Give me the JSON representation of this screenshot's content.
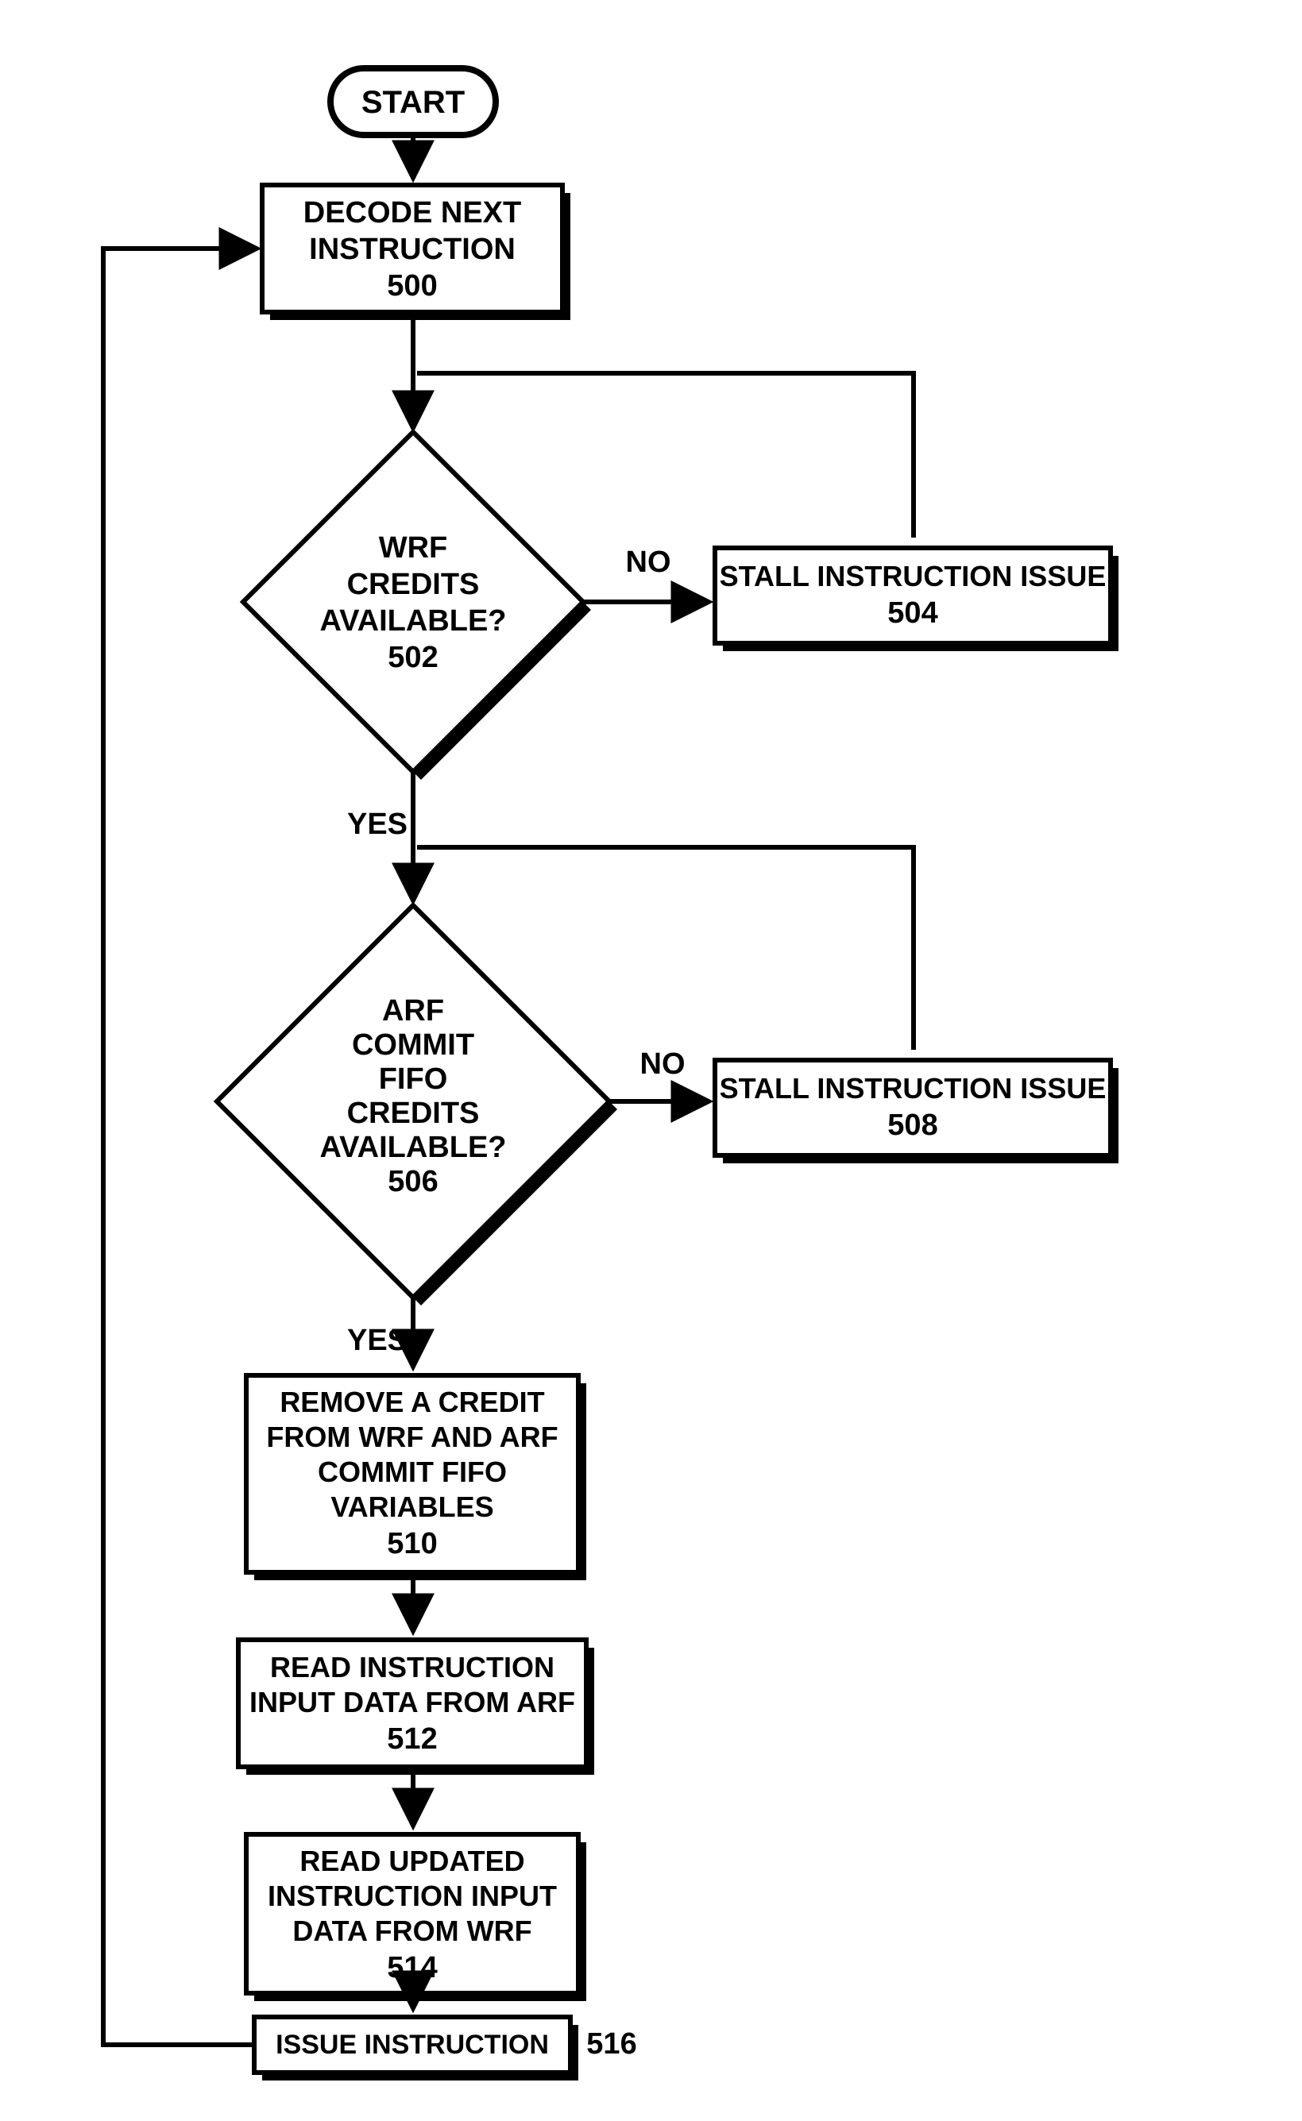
{
  "start": "START",
  "nodes": {
    "decode": {
      "l1": "DECODE NEXT",
      "l2": "INSTRUCTION",
      "num": "500"
    },
    "wrf": {
      "l1": "WRF",
      "l2": "CREDITS",
      "l3": "AVAILABLE?",
      "num": "502"
    },
    "stall504": {
      "l1": "STALL INSTRUCTION ISSUE",
      "num": "504"
    },
    "arf": {
      "l1": "ARF",
      "l2": "COMMIT",
      "l3": "FIFO",
      "l4": "CREDITS",
      "l5": "AVAILABLE?",
      "num": "506"
    },
    "stall508": {
      "l1": "STALL INSTRUCTION ISSUE",
      "num": "508"
    },
    "remove": {
      "l1": "REMOVE A CREDIT",
      "l2": "FROM WRF AND ARF",
      "l3": "COMMIT FIFO",
      "l4": "VARIABLES",
      "num": "510"
    },
    "readARF": {
      "l1": "READ INSTRUCTION",
      "l2": "INPUT DATA FROM ARF",
      "num": "512"
    },
    "readWRF": {
      "l1": "READ UPDATED",
      "l2": "INSTRUCTION INPUT",
      "l3": "DATA FROM WRF",
      "num": "514"
    },
    "issue": {
      "l1": "ISSUE INSTRUCTION",
      "num": "516"
    }
  },
  "labels": {
    "no": "NO",
    "yes": "YES"
  }
}
